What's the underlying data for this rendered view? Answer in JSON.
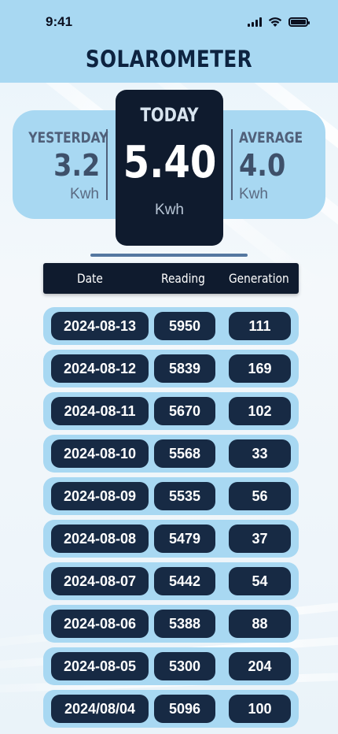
{
  "status_bar": {
    "time": "9:41"
  },
  "app": {
    "title": "SOLAROMETER"
  },
  "summary": {
    "yesterday": {
      "label": "YESTERDAY",
      "value": "3.2",
      "unit": "Kwh"
    },
    "today": {
      "label": "TODAY",
      "value": "5.40",
      "unit": "Kwh"
    },
    "average": {
      "label": "AVERAGE",
      "value": "4.0",
      "unit": "Kwh"
    }
  },
  "table": {
    "columns": [
      "Date",
      "Reading",
      "Generation"
    ],
    "rows": [
      {
        "date": "2024-08-13",
        "reading": "5950",
        "generation": "111"
      },
      {
        "date": "2024-08-12",
        "reading": "5839",
        "generation": "169"
      },
      {
        "date": "2024-08-11",
        "reading": "5670",
        "generation": "102"
      },
      {
        "date": "2024-08-10",
        "reading": "5568",
        "generation": "33"
      },
      {
        "date": "2024-08-09",
        "reading": "5535",
        "generation": "56"
      },
      {
        "date": "2024-08-08",
        "reading": "5479",
        "generation": "37"
      },
      {
        "date": "2024-08-07",
        "reading": "5442",
        "generation": "54"
      },
      {
        "date": "2024-08-06",
        "reading": "5388",
        "generation": "88"
      },
      {
        "date": "2024-08-05",
        "reading": "5300",
        "generation": "204"
      },
      {
        "date": "2024/08/04",
        "reading": "5096",
        "generation": "100"
      }
    ]
  },
  "colors": {
    "header_bg": "#a8d8f2",
    "card_dark": "#0f1b2e",
    "pill_dark": "#172a44",
    "title_text": "#0d2340"
  },
  "icons": [
    "cellular-signal-icon",
    "wifi-icon",
    "battery-icon"
  ]
}
